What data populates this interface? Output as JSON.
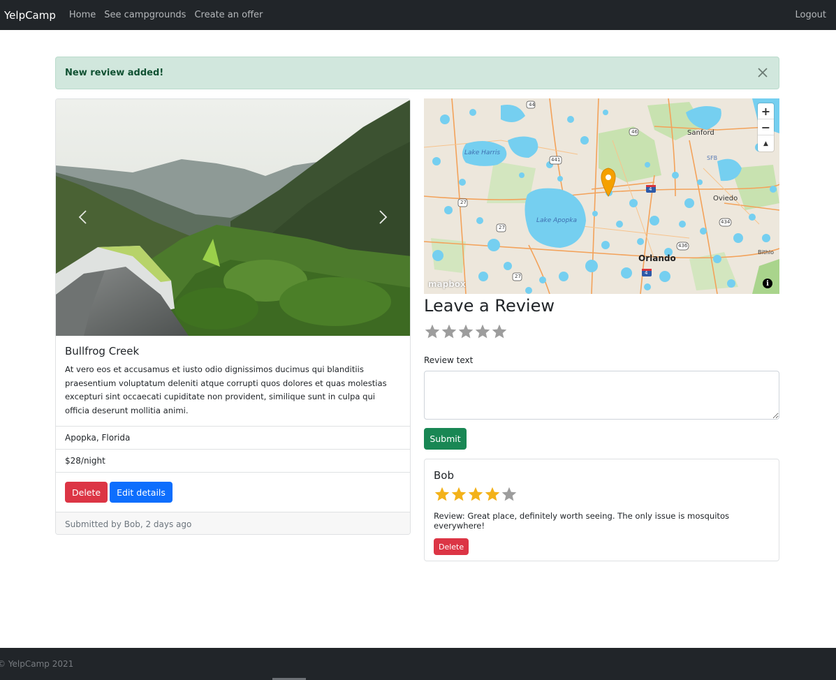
{
  "navbar": {
    "brand": "YelpCamp",
    "links": [
      "Home",
      "See campgrounds",
      "Create an offer"
    ],
    "logout": "Logout"
  },
  "alert": {
    "message": "New review added!",
    "close_icon": "close-icon"
  },
  "campground": {
    "title": "Bullfrog Creek",
    "description": "At vero eos et accusamus et iusto odio dignissimos ducimus qui blanditiis praesentium voluptatum deleniti atque corrupti quos dolores et quas molestias excepturi sint occaecati cupiditate non provident, similique sunt in culpa qui officia deserunt mollitia animi.",
    "location": "Apopka, Florida",
    "price": "$28/night",
    "delete_label": "Delete",
    "edit_label": "Edit details",
    "submitted_by": "Submitted by Bob, 2 days ago"
  },
  "carousel": {
    "prev_icon": "chevron-left-icon",
    "next_icon": "chevron-right-icon"
  },
  "map": {
    "zoom_in": "+",
    "zoom_out": "−",
    "compass": "▲",
    "attribution_logo": "mapbox",
    "info": "i",
    "labels": {
      "lake_harris": "Lake Harris",
      "lake_apopka": "Lake Apopka",
      "sanford": "Sanford",
      "sfb": "SFB",
      "oviedo": "Oviedo",
      "orlando": "Orlando",
      "bithlo": "Bithlo",
      "r44": "44",
      "r46": "46",
      "r441": "441",
      "r27a": "27",
      "r27b": "27",
      "r27c": "27",
      "r434": "434",
      "r436": "436",
      "i4a": "4",
      "i4b": "4"
    },
    "colors": {
      "land": "#ede7dc",
      "water": "#75cff0",
      "park": "#c8e2b0",
      "road": "#f3a25a",
      "marker": "#f5a000"
    }
  },
  "review_form": {
    "title": "Leave a Review",
    "rating_value": 0,
    "rating_max": 5,
    "label": "Review text",
    "textarea_value": "",
    "submit_label": "Submit"
  },
  "reviews": [
    {
      "author": "Bob",
      "rating": 4,
      "rating_max": 5,
      "text": "Review: Great place, definitely worth seeing. The only issue is mosquitos everywhere!",
      "delete_label": "Delete"
    }
  ],
  "footer": {
    "copyright": "© YelpCamp 2021"
  },
  "colors": {
    "navbar_bg": "#212529",
    "alert_bg": "#d1e7dd",
    "alert_text": "#0f5132",
    "danger": "#dc3545",
    "primary": "#0d6efd",
    "success": "#198754",
    "star_filled": "#f3b21a",
    "star_empty": "#9d9d9d"
  }
}
